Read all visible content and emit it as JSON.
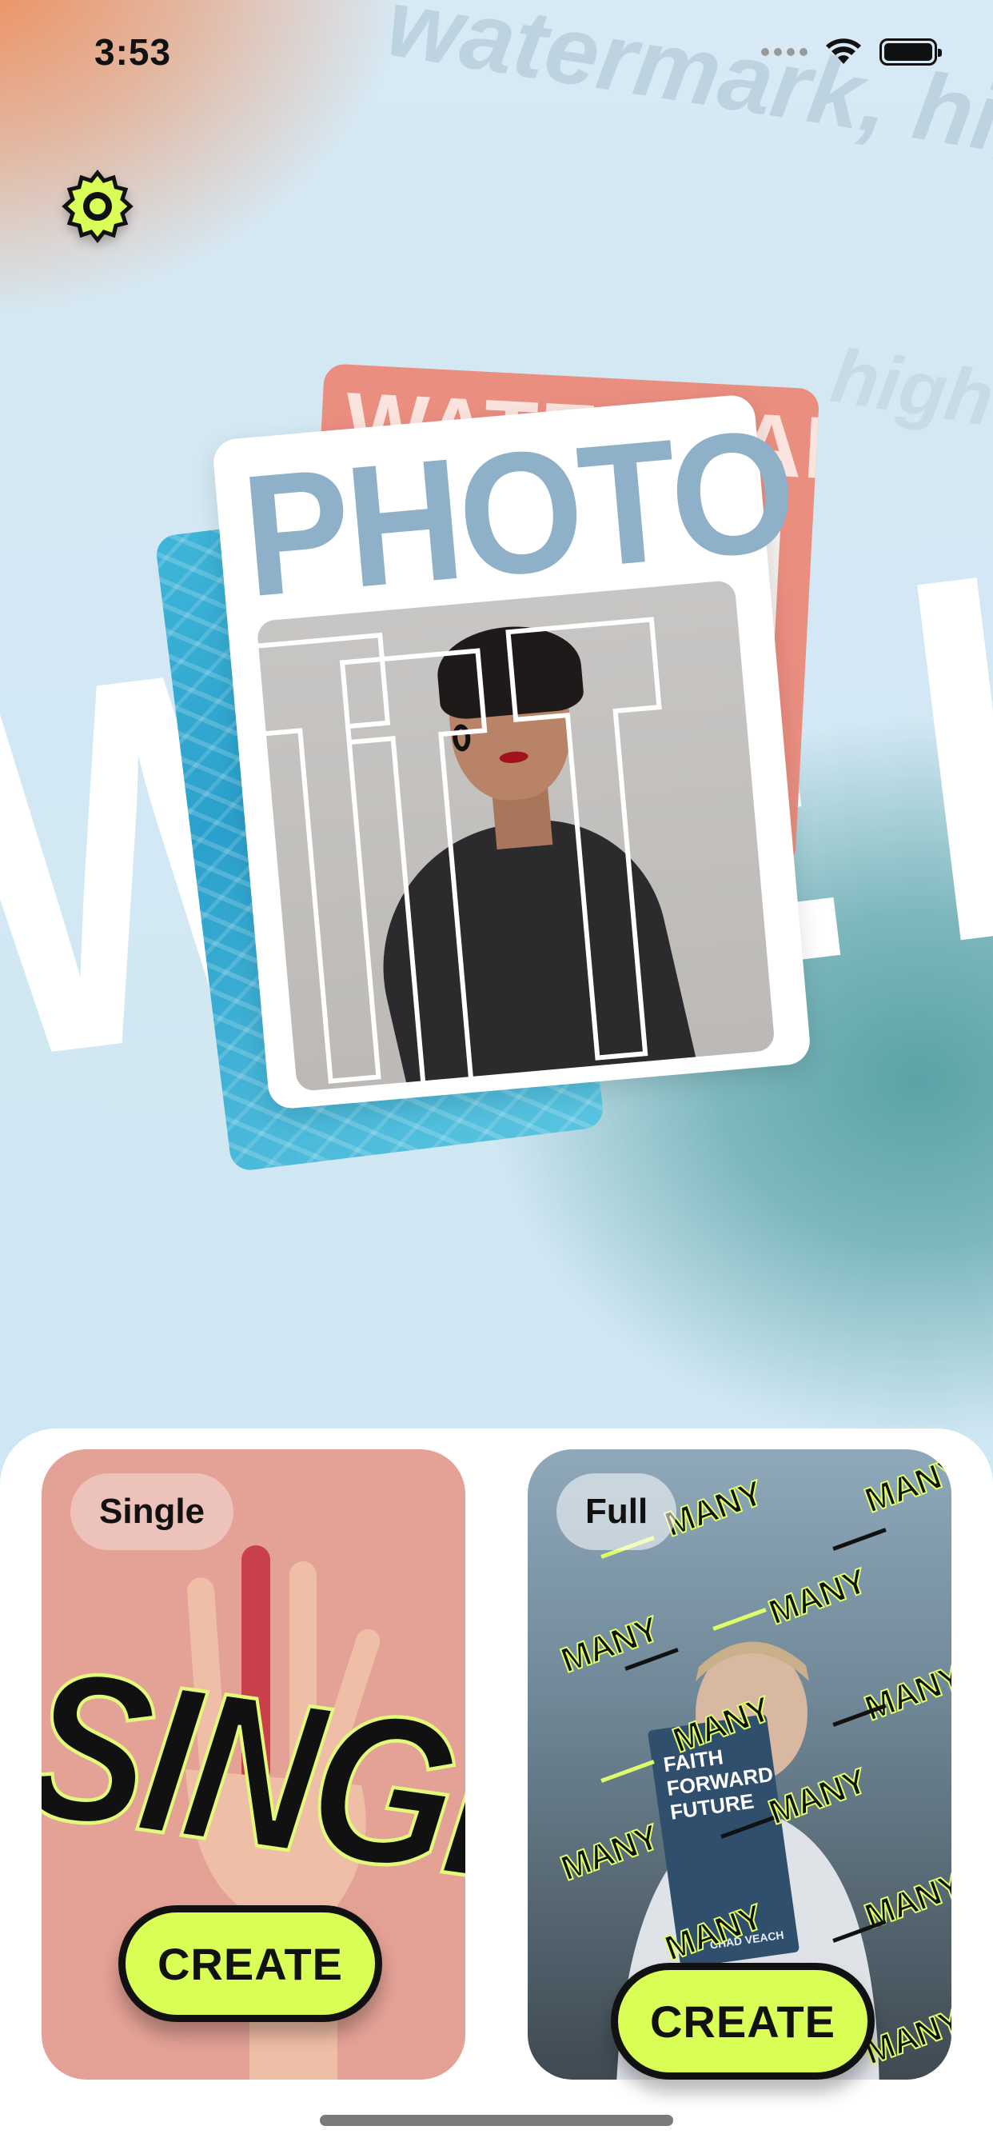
{
  "status_bar": {
    "time": "3:53"
  },
  "background": {
    "watermark_text": "watermark, high",
    "watermark_text_2": "high",
    "giant_text": "WTE I"
  },
  "hero": {
    "photo_word": "PHOTO",
    "red_card_text": "WATERMARK",
    "outline_letters": "TT"
  },
  "tiles": [
    {
      "label": "Single",
      "art_word": "SINGLE",
      "button": "CREATE"
    },
    {
      "label": "Full",
      "art_word": "MANY",
      "button": "CREATE",
      "book_lines": [
        "FAITH",
        "FORWARD",
        "FUTURE"
      ],
      "book_author": "CHAD VEACH"
    }
  ],
  "colors": {
    "accent": "#d9ff57",
    "single_bg": "#e4a196",
    "ink": "#111111"
  },
  "icons": {
    "settings": "gear-icon"
  }
}
